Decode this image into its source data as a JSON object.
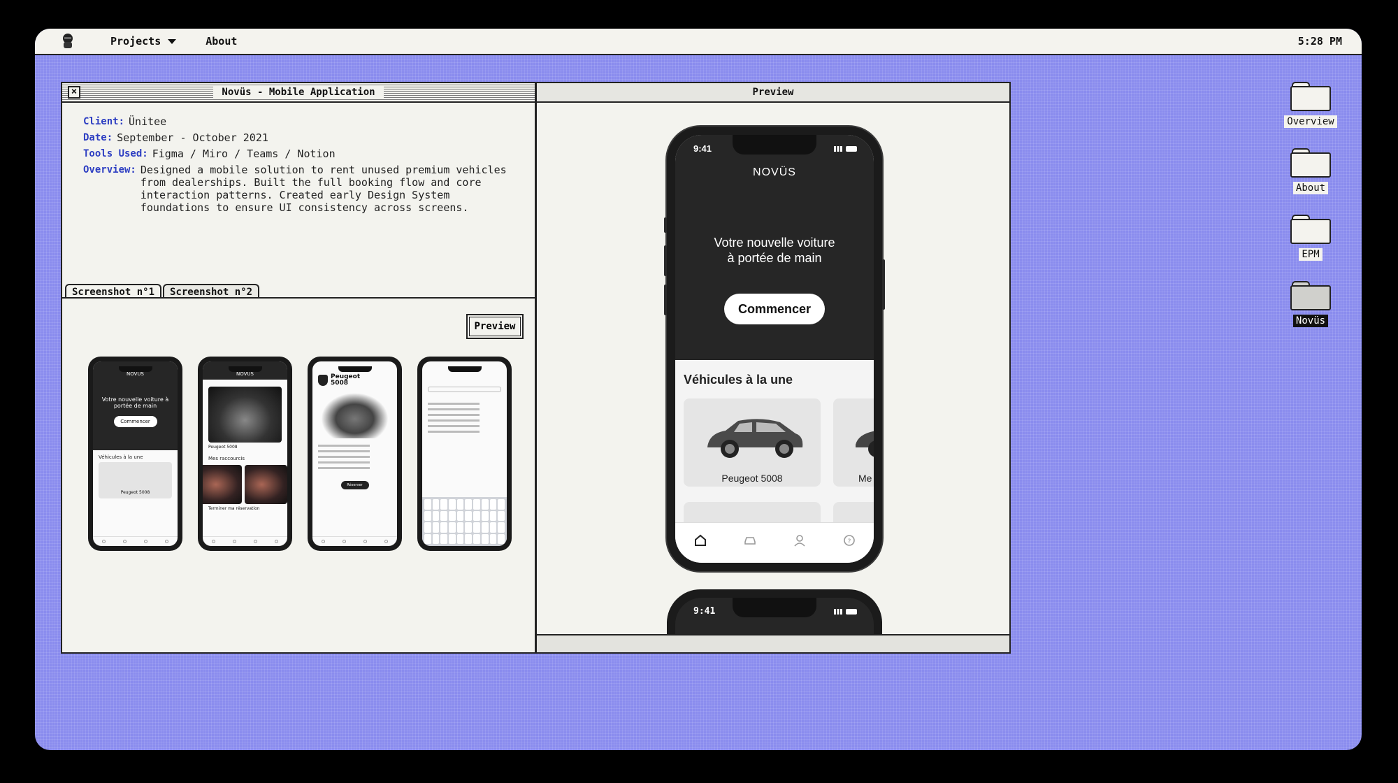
{
  "menubar": {
    "projects_label": "Projects",
    "about_label": "About",
    "clock": "5:28 PM"
  },
  "main_window": {
    "title": "Novüs - Mobile Application",
    "client_label": "Client:",
    "client_value": "Ünitee",
    "date_label": "Date:",
    "date_value": "September - October 2021",
    "tools_label": "Tools Used:",
    "tools_value": "Figma / Miro / Teams / Notion",
    "overview_label": "Overview:",
    "overview_value": "Designed a mobile solution to rent unused premium vehicles from dealerships. Built the full booking flow and core interaction patterns. Created early Design System foundations to ensure UI consistency across screens.",
    "tabs": [
      "Screenshot n°1",
      "Screenshot n°2"
    ],
    "active_tab": 0,
    "preview_button": "Preview",
    "thumbs": {
      "t1_brand": "NOVÜS",
      "t1_tagline": "Votre nouvelle voiture à portée de main",
      "t1_cta": "Commencer",
      "t1_section": "Véhicules à la une",
      "t1_card": "Peugeot 5008",
      "t2_brand": "NOVÜS",
      "t2_caption": "Peugeot 5008",
      "t2_section": "Mes raccourcis",
      "t2_shortcut": "Terminer ma réservation",
      "t3_brand_line1": "Peugeot",
      "t3_brand_line2": "5008",
      "t3_button": "Réserver"
    }
  },
  "preview_window": {
    "title": "Preview",
    "phone": {
      "time": "9:41",
      "brand": "NOVÜS",
      "tagline_line1": "Votre nouvelle voiture",
      "tagline_line2": "à portée de main",
      "cta": "Commencer",
      "section_title": "Véhicules à la une",
      "card1_label": "Peugeot 5008",
      "card2_label": "Me"
    },
    "phone2": {
      "time": "9:41"
    }
  },
  "desktop_icons": [
    {
      "label": "Overview",
      "selected": false
    },
    {
      "label": "About",
      "selected": false
    },
    {
      "label": "EPM",
      "selected": false
    },
    {
      "label": "Novüs",
      "selected": true
    }
  ],
  "colors": {
    "desktop": "#8a8cee",
    "label_accent": "#2d3ec2",
    "window_bg": "#f3f3ee"
  },
  "icons": [
    "app-logo-icon",
    "caret-down-icon",
    "close-icon",
    "folder-icon",
    "home-icon",
    "car-icon",
    "user-icon",
    "help-icon"
  ]
}
